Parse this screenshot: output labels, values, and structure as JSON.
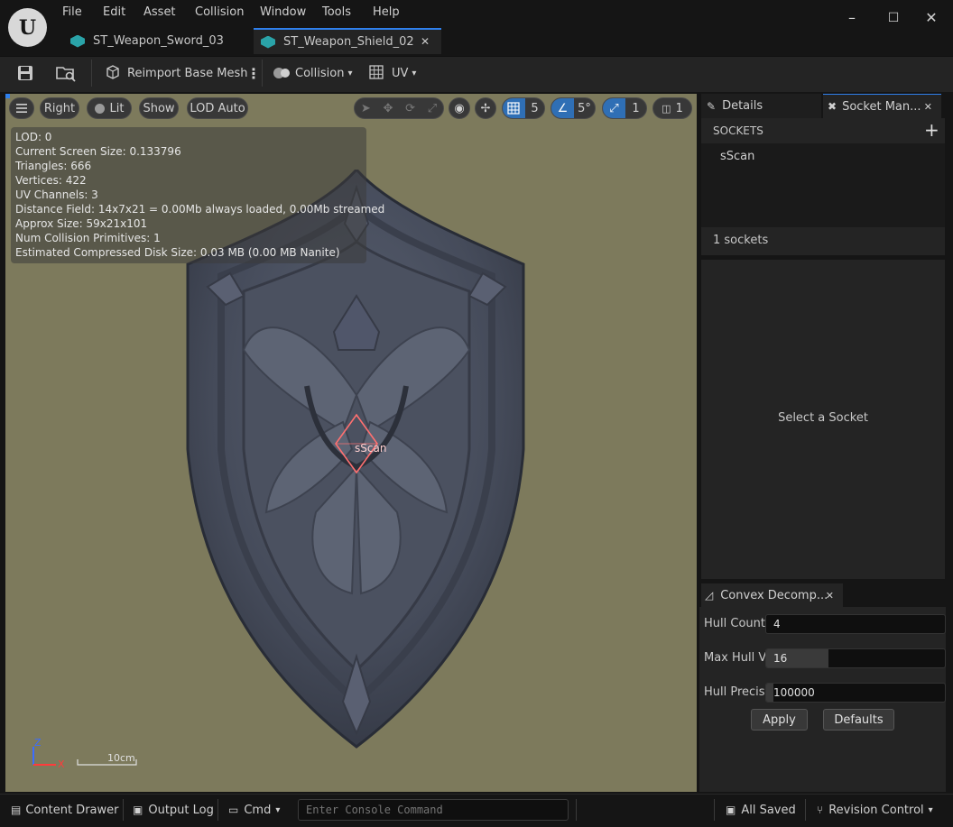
{
  "menu": [
    "File",
    "Edit",
    "Asset",
    "Collision",
    "Window",
    "Tools",
    "Help"
  ],
  "tabs": [
    {
      "label": "ST_Weapon_Sword_03",
      "active": false
    },
    {
      "label": "ST_Weapon_Shield_02",
      "active": true
    }
  ],
  "window_controls": {
    "minimize": "–",
    "maximize": "☐",
    "close": "✕"
  },
  "toolbar": {
    "reimport": "Reimport Base Mesh",
    "collision": "Collision",
    "uv": "UV"
  },
  "viewport": {
    "menu_icon": "hamburger-icon",
    "view_mode": "Right",
    "lighting": "Lit",
    "show": "Show",
    "lod": "LOD Auto",
    "grid_snap": "5",
    "rotation_snap": "5°",
    "scale_snap": "1",
    "camera_speed": "1",
    "stats": [
      "LOD:  0",
      "Current Screen Size:  0.133796",
      "Triangles:  666",
      "Vertices:  422",
      "UV Channels:  3",
      "Distance Field:  14x7x21 = 0.00Mb always loaded, 0.00Mb streamed",
      "Approx Size:  59x21x101",
      "Num Collision Primitives:  1",
      "Estimated Compressed Disk Size: 0.03 MB (0.00 MB Nanite)"
    ],
    "socket_label": "sScan",
    "axis_z": "Z",
    "axis_x": "X",
    "scale": "10cm"
  },
  "details_tab": "Details",
  "socket_manager_tab": "Socket Man...",
  "sockets": {
    "header": "SOCKETS",
    "items": [
      "sScan"
    ],
    "count": "1 sockets",
    "empty_message": "Select a Socket"
  },
  "convex": {
    "tab": "Convex Decomp...",
    "hull_count_label": "Hull Count",
    "hull_count": "4",
    "max_hull_label": "Max Hull Ve",
    "max_hull": "16",
    "max_hull_fill": 0.35,
    "hull_precision_label": "Hull Precisi",
    "hull_precision": "100000",
    "hull_precision_fill": 0.04,
    "apply": "Apply",
    "defaults": "Defaults"
  },
  "statusbar": {
    "content_drawer": "Content Drawer",
    "output_log": "Output Log",
    "cmd": "Cmd",
    "console_placeholder": "Enter Console Command",
    "saved": "All Saved",
    "revision": "Revision Control"
  },
  "colors": {
    "accent": "#2f80ed",
    "viewport_bg": "#7d7a5c",
    "socket": "#ff7070"
  }
}
